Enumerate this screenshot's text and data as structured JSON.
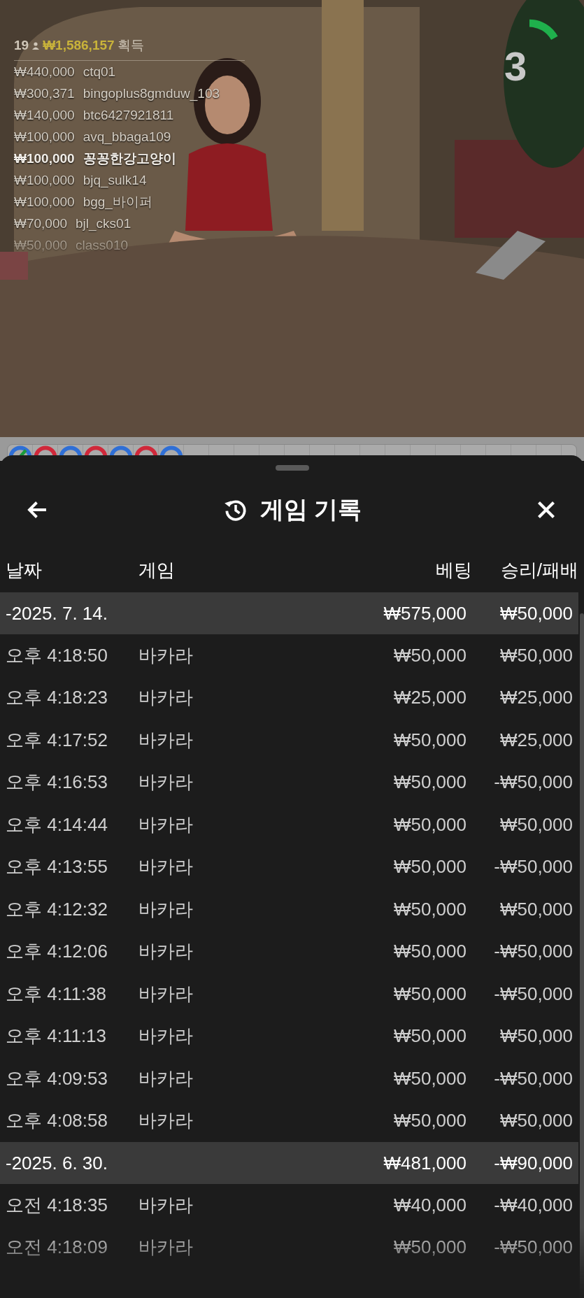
{
  "leaderboard": {
    "count": "19",
    "total": "₩1,586,157",
    "suffix": "획득",
    "entries": [
      {
        "amount": "₩440,000",
        "name": "ctq01",
        "highlight": false
      },
      {
        "amount": "₩300,371",
        "name": "bingoplus8gmduw_103",
        "highlight": false
      },
      {
        "amount": "₩140,000",
        "name": "btc6427921811",
        "highlight": false
      },
      {
        "amount": "₩100,000",
        "name": "avq_bbaga109",
        "highlight": false
      },
      {
        "amount": "₩100,000",
        "name": "꽁꽁한강고양이",
        "highlight": true
      },
      {
        "amount": "₩100,000",
        "name": "bjq_sulk14",
        "highlight": false
      },
      {
        "amount": "₩100,000",
        "name": "bgg_바이퍼",
        "highlight": false
      },
      {
        "amount": "₩70,000",
        "name": "bjl_cks01",
        "highlight": false
      },
      {
        "amount": "₩50,000",
        "name": "class010",
        "highlight": false
      }
    ]
  },
  "timer": {
    "value": "3",
    "level": 0.17
  },
  "bead_road": [
    {
      "color": "#2f6fd6",
      "tie": true
    },
    {
      "color": "#d0283a",
      "tie": false
    },
    {
      "color": "#2f6fd6",
      "tie": false
    },
    {
      "color": "#d0283a",
      "tie": false
    },
    {
      "color": "#2f6fd6",
      "tie": false
    },
    {
      "color": "#d0283a",
      "tie": false
    },
    {
      "color": "#2f6fd6",
      "tie": false
    }
  ],
  "sheet": {
    "title": "게임 기록",
    "columns": [
      "날짜",
      "게임",
      "베팅",
      "승리/패배"
    ],
    "groups": [
      {
        "date": "-2025. 7. 14.",
        "bet": "₩575,000",
        "result": "₩50,000",
        "rows": [
          {
            "time": "오후 4:18:50",
            "game": "바카라",
            "bet": "₩50,000",
            "result": "₩50,000"
          },
          {
            "time": "오후 4:18:23",
            "game": "바카라",
            "bet": "₩25,000",
            "result": "₩25,000"
          },
          {
            "time": "오후 4:17:52",
            "game": "바카라",
            "bet": "₩50,000",
            "result": "₩25,000"
          },
          {
            "time": "오후 4:16:53",
            "game": "바카라",
            "bet": "₩50,000",
            "result": "-₩50,000"
          },
          {
            "time": "오후 4:14:44",
            "game": "바카라",
            "bet": "₩50,000",
            "result": "₩50,000"
          },
          {
            "time": "오후 4:13:55",
            "game": "바카라",
            "bet": "₩50,000",
            "result": "-₩50,000"
          },
          {
            "time": "오후 4:12:32",
            "game": "바카라",
            "bet": "₩50,000",
            "result": "₩50,000"
          },
          {
            "time": "오후 4:12:06",
            "game": "바카라",
            "bet": "₩50,000",
            "result": "-₩50,000"
          },
          {
            "time": "오후 4:11:38",
            "game": "바카라",
            "bet": "₩50,000",
            "result": "-₩50,000"
          },
          {
            "time": "오후 4:11:13",
            "game": "바카라",
            "bet": "₩50,000",
            "result": "₩50,000"
          },
          {
            "time": "오후 4:09:53",
            "game": "바카라",
            "bet": "₩50,000",
            "result": "-₩50,000"
          },
          {
            "time": "오후 4:08:58",
            "game": "바카라",
            "bet": "₩50,000",
            "result": "₩50,000"
          }
        ]
      },
      {
        "date": "-2025. 6. 30.",
        "bet": "₩481,000",
        "result": "-₩90,000",
        "rows": [
          {
            "time": "오전 4:18:35",
            "game": "바카라",
            "bet": "₩40,000",
            "result": "-₩40,000"
          },
          {
            "time": "오전 4:18:09",
            "game": "바카라",
            "bet": "₩50,000",
            "result": "-₩50,000"
          }
        ]
      }
    ]
  }
}
